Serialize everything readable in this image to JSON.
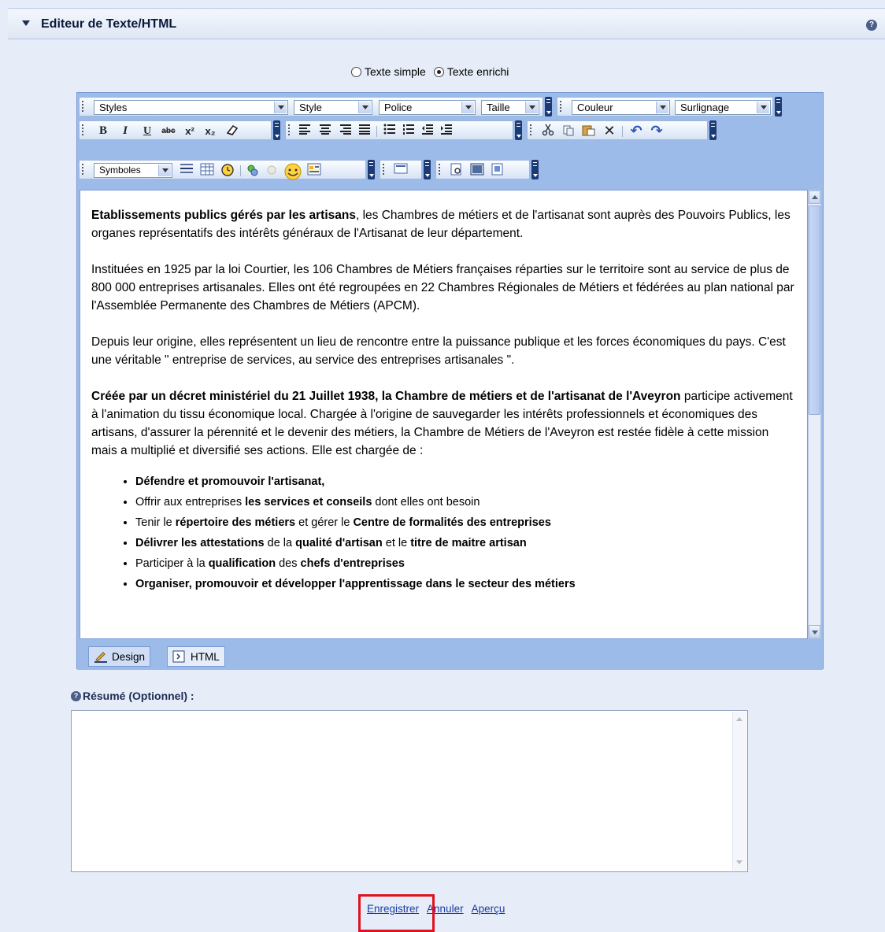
{
  "panel": {
    "title": "Editeur de Texte/HTML",
    "help_icon": "?"
  },
  "mode": {
    "options": [
      "Texte simple",
      "Texte enrichi"
    ],
    "selected": "Texte enrichi"
  },
  "toolbar": {
    "row1": {
      "styles": "Styles",
      "style": "Style",
      "police": "Police",
      "taille": "Taille",
      "couleur": "Couleur",
      "surlignage": "Surlignage"
    },
    "row2": {
      "bold": "B",
      "italic": "I",
      "underline": "U",
      "strike": "abc",
      "superscript": "x²",
      "subscript": "x₂"
    },
    "row3": {
      "symboles": "Symboles"
    }
  },
  "content": {
    "p1_bold": "Etablissements publics gérés par les artisans",
    "p1_rest": ", les Chambres de métiers et de l'artisanat sont auprès des Pouvoirs Publics, les organes représentatifs des intérêts généraux de l'Artisanat de leur département.",
    "p2": "Instituées en 1925 par la loi Courtier, les 106 Chambres de Métiers françaises réparties sur le territoire sont au service de plus de 800 000 entreprises artisanales. Elles ont été regroupées en 22 Chambres Régionales de Métiers et fédérées au plan national par l'Assemblée Permanente des Chambres de Métiers (APCM).",
    "p3": "Depuis leur origine, elles représentent un lieu de rencontre entre la puissance publique et les forces économiques du pays. C'est une véritable \" entreprise de services, au service des entreprises artisanales \".",
    "p4_bold": "Créée par un décret ministériel du 21 Juillet 1938, la Chambre de métiers et de l'artisanat de l'Aveyron",
    "p4_rest": " participe activement à l'animation du tissu économique local. Chargée à l'origine de sauvegarder les intérêts professionnels et économiques des artisans, d'assurer la pérennité et le devenir des métiers, la Chambre de Métiers de l'Aveyron est restée fidèle à cette mission mais a multiplié et diversifié ses actions. Elle est chargée de :",
    "bullets": {
      "b1": "Défendre et promouvoir l'artisanat,",
      "b2_a": "Offrir aux entreprises ",
      "b2_b": "les services et conseils",
      "b2_c": " dont elles ont besoin",
      "b3_a": "Tenir le ",
      "b3_b": "répertoire des métiers",
      "b3_c": " et gérer le ",
      "b3_d": "Centre de formalités des entreprises",
      "b4_a": "Délivrer les attestations",
      "b4_b": " de la ",
      "b4_c": "qualité d'artisan",
      "b4_d": " et le ",
      "b4_e": "titre de maitre artisan",
      "b5_a": "Participer à la ",
      "b5_b": "qualification",
      "b5_c": " des ",
      "b5_d": "chefs d'entreprises",
      "b6": "Organiser, promouvoir et développer l'apprentissage dans le secteur des métiers"
    }
  },
  "tabs": {
    "design": "Design",
    "html": "HTML",
    "active": "Design"
  },
  "summary": {
    "label": "Résumé (Optionnel) :",
    "value": ""
  },
  "actions": {
    "save": "Enregistrer",
    "cancel": "Annuler",
    "preview": "Aperçu"
  },
  "colors": {
    "toolbar_bg": "#9dbbe8",
    "highlight": "#e0121f",
    "link": "#1b3ba5"
  }
}
